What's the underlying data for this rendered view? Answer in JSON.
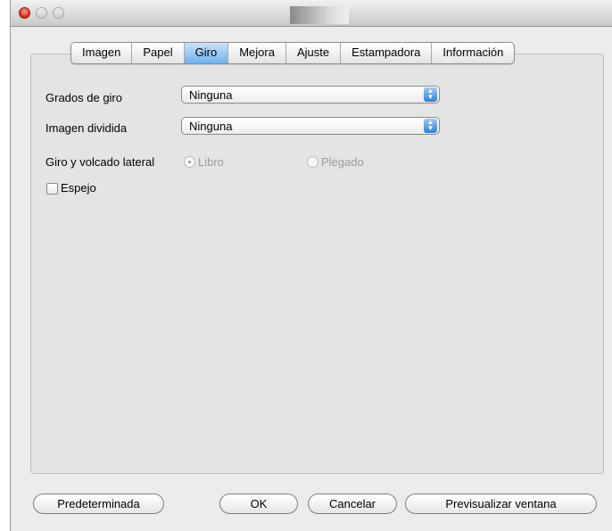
{
  "tabs": [
    "Imagen",
    "Papel",
    "Giro",
    "Mejora",
    "Ajuste",
    "Estampadora",
    "Información"
  ],
  "active_tab": "Giro",
  "rotation": {
    "label": "Grados de giro",
    "value": "Ninguna"
  },
  "split": {
    "label": "Imagen dividida",
    "value": "Ninguna"
  },
  "flip": {
    "label": "Giro y volcado lateral",
    "option_book": "Libro",
    "option_fold": "Plegado"
  },
  "mirror": {
    "label": "Espejo"
  },
  "buttons": {
    "default": "Predeterminada",
    "ok": "OK",
    "cancel": "Cancelar",
    "preview": "Previsualizar ventana"
  },
  "icons": {
    "stepper": "up-down-arrows-icon"
  },
  "colors": {
    "accent": "#6fb1ef",
    "close_light": "#d0281b",
    "window_bg": "#ececec"
  }
}
